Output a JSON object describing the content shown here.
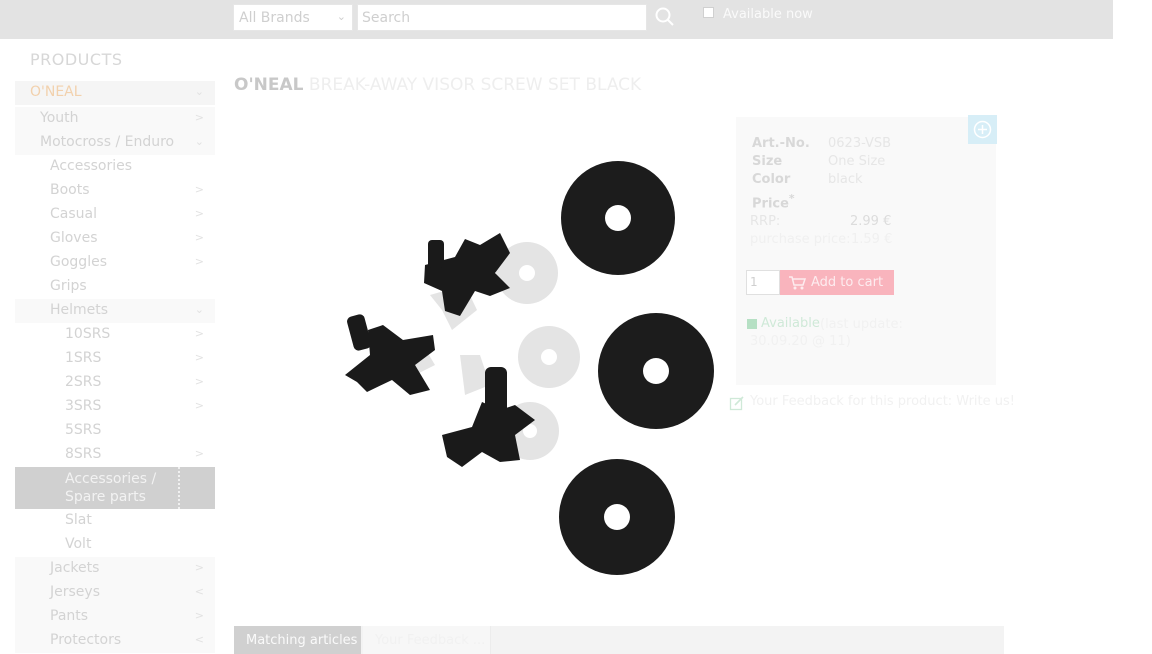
{
  "topbar": {
    "brand_select_value": "All Brands",
    "search_placeholder": "Search",
    "available_now_label": "Available now"
  },
  "sidebar": {
    "title": "PRODUCTS",
    "items": [
      {
        "label": "O'NEAL",
        "arrow": "⌄"
      },
      {
        "label": "Youth",
        "arrow": ">"
      },
      {
        "label": "Motocross / Enduro",
        "arrow": "⌄"
      },
      {
        "label": "Accessories",
        "arrow": ""
      },
      {
        "label": "Boots",
        "arrow": ">"
      },
      {
        "label": "Casual",
        "arrow": ">"
      },
      {
        "label": "Gloves",
        "arrow": ">"
      },
      {
        "label": "Goggles",
        "arrow": ">"
      },
      {
        "label": "Grips",
        "arrow": ""
      },
      {
        "label": "Helmets",
        "arrow": "⌄"
      },
      {
        "label": "10SRS",
        "arrow": ">"
      },
      {
        "label": "1SRS",
        "arrow": ">"
      },
      {
        "label": "2SRS",
        "arrow": ">"
      },
      {
        "label": "3SRS",
        "arrow": ">"
      },
      {
        "label": "5SRS",
        "arrow": ""
      },
      {
        "label": "8SRS",
        "arrow": ">"
      },
      {
        "label": "Accessories / Spare parts",
        "arrow": ""
      },
      {
        "label": "Slat",
        "arrow": ""
      },
      {
        "label": "Volt",
        "arrow": ""
      },
      {
        "label": "Jackets",
        "arrow": ">"
      },
      {
        "label": "Jerseys",
        "arrow": "<"
      },
      {
        "label": "Pants",
        "arrow": ">"
      },
      {
        "label": "Protectors",
        "arrow": "<"
      }
    ]
  },
  "product": {
    "brand": "O'NEAL",
    "name": "BREAK-AWAY VISOR SCREW SET BLACK",
    "details": [
      {
        "key": "Art.-No.",
        "value": "0623-VSB"
      },
      {
        "key": "Size",
        "value": "One Size"
      },
      {
        "key": "Color",
        "value": "black"
      }
    ],
    "price_label": "Price",
    "price_marker": "*",
    "rrp_label": "RRP:",
    "rrp_value": "2.99 €",
    "purchase_label": "purchase price:",
    "purchase_value": "1.59 €",
    "quantity": "1",
    "add_to_cart_label": "Add to cart",
    "availability_status": "Available",
    "availability_detail": "(last update: 30.09.20 @ 11)",
    "feedback_text": "Your Feedback for this product: Write us!"
  },
  "tabs": [
    {
      "label": "Matching articles"
    },
    {
      "label": "Your Feedback ..."
    }
  ],
  "colors": {
    "accent_orange": "#f2d1ad",
    "cart_red": "#f9b4bd",
    "available_green": "#b6e0c4"
  }
}
